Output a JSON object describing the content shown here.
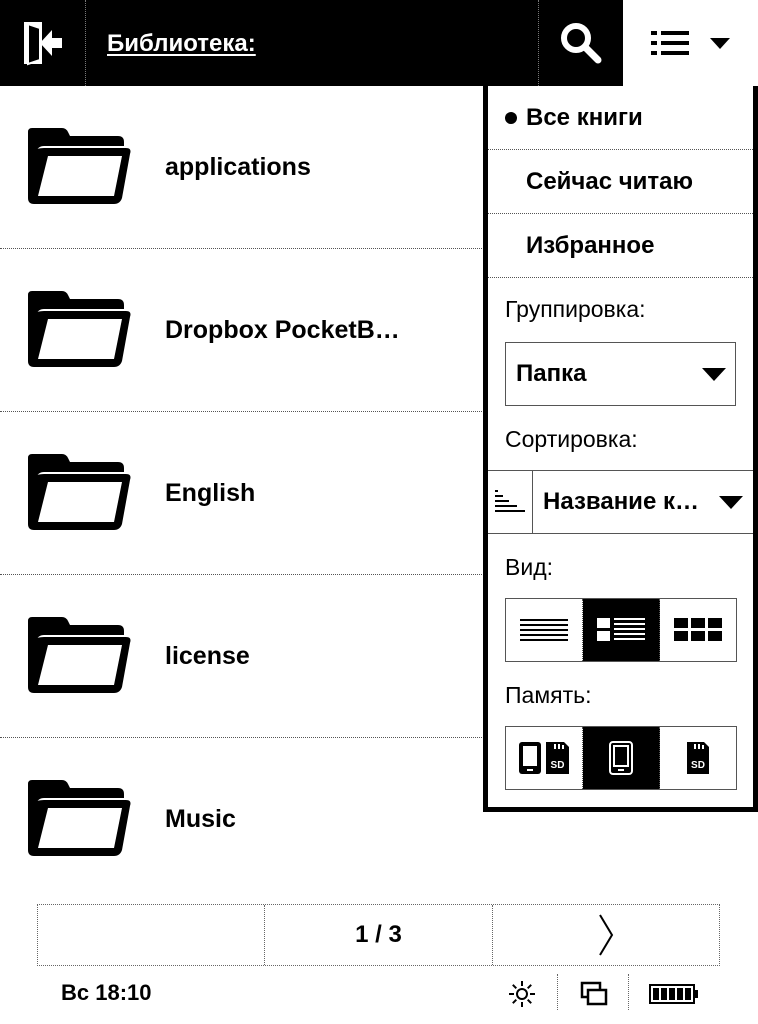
{
  "header": {
    "title": "Библиотека:",
    "exit_icon": "exit-icon",
    "search_icon": "search-icon",
    "menu_icon": "list-menu-icon"
  },
  "files": [
    {
      "name": "applications",
      "icon": "folder-icon"
    },
    {
      "name": "Dropbox PocketB…",
      "icon": "folder-icon"
    },
    {
      "name": "English",
      "icon": "folder-icon"
    },
    {
      "name": "license",
      "icon": "folder-icon"
    },
    {
      "name": "Music",
      "icon": "folder-icon"
    }
  ],
  "menu": {
    "filters": [
      {
        "label": "Все книги",
        "selected": true
      },
      {
        "label": "Сейчас читаю",
        "selected": false
      },
      {
        "label": "Избранное",
        "selected": false
      }
    ],
    "grouping_label": "Группировка:",
    "grouping_value": "Папка",
    "sorting_label": "Сортировка:",
    "sorting_value": "Название к…",
    "view_label": "Вид:",
    "view_options": [
      "list-view-icon",
      "detailed-list-view-icon",
      "grid-view-icon"
    ],
    "view_selected": 1,
    "memory_label": "Память:",
    "memory_options": [
      "internal-and-sd-icon",
      "internal-memory-icon",
      "sd-card-icon"
    ],
    "memory_selected": 1
  },
  "pager": {
    "page": "1 / 3",
    "next_icon": "chevron-right-icon"
  },
  "status": {
    "time": "Вс 18:10",
    "icons": [
      "brightness-icon",
      "tasks-icon",
      "battery-icon"
    ]
  }
}
